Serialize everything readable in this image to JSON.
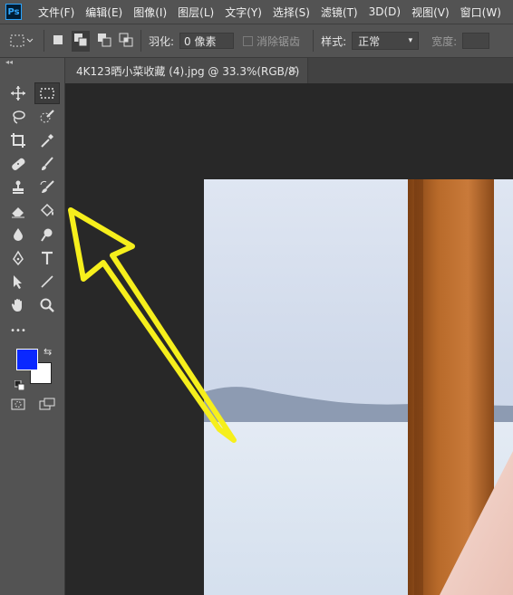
{
  "menu": {
    "logo": "Ps",
    "items": [
      "文件(F)",
      "编辑(E)",
      "图像(I)",
      "图层(L)",
      "文字(Y)",
      "选择(S)",
      "滤镜(T)",
      "3D(D)",
      "视图(V)",
      "窗口(W)"
    ]
  },
  "options": {
    "feather_label": "羽化:",
    "feather_value": "0 像素",
    "antialias_label": "消除锯齿",
    "style_label": "样式:",
    "style_value": "正常",
    "width_label": "宽度:"
  },
  "document": {
    "tab_title": "4K123晒小菜收藏 (4).jpg @ 33.3%(RGB/8)",
    "close": "×"
  },
  "toolbar": {
    "collapse": "◂◂",
    "more": "•••"
  },
  "colors": {
    "foreground": "#0a28ff",
    "background": "#ffffff",
    "annotation_arrow": "#f6ef1c"
  }
}
